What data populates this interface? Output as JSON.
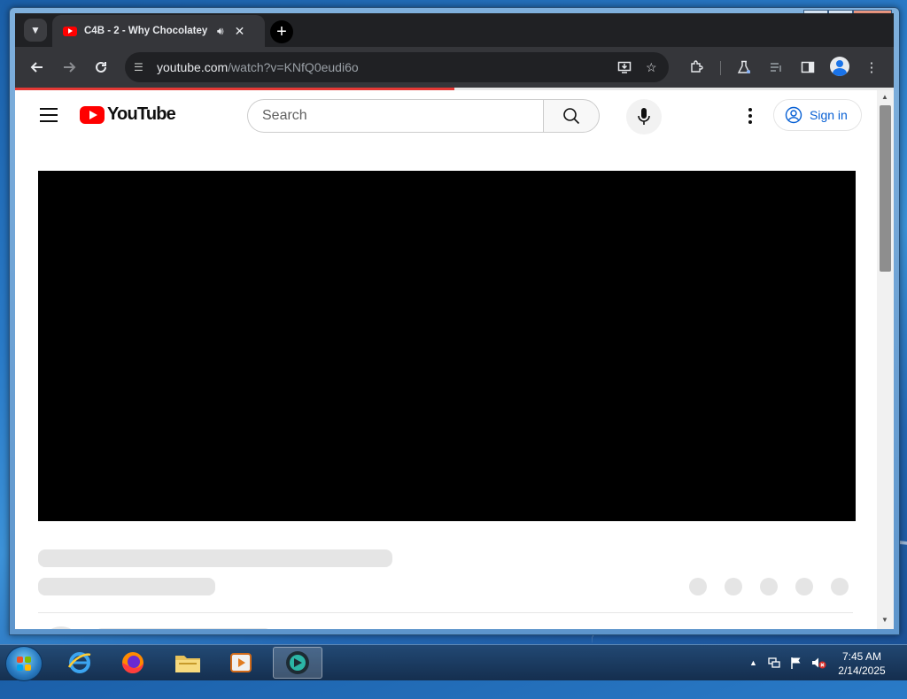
{
  "browser": {
    "tab": {
      "title": "C4B - 2 - Why Chocolatey",
      "favicon": "youtube-favicon-icon"
    },
    "url": {
      "host": "youtube.com",
      "path": "/watch?v=KNfQ0eudi6o"
    }
  },
  "youtube": {
    "logo_text": "YouTube",
    "search_placeholder": "Search",
    "sign_in_label": "Sign in",
    "brand_color": "#ff0000",
    "link_color": "#065fd4"
  },
  "page": {
    "load_progress_percent": 50
  },
  "taskbar": {
    "time": "7:45 AM",
    "date": "2/14/2025"
  }
}
